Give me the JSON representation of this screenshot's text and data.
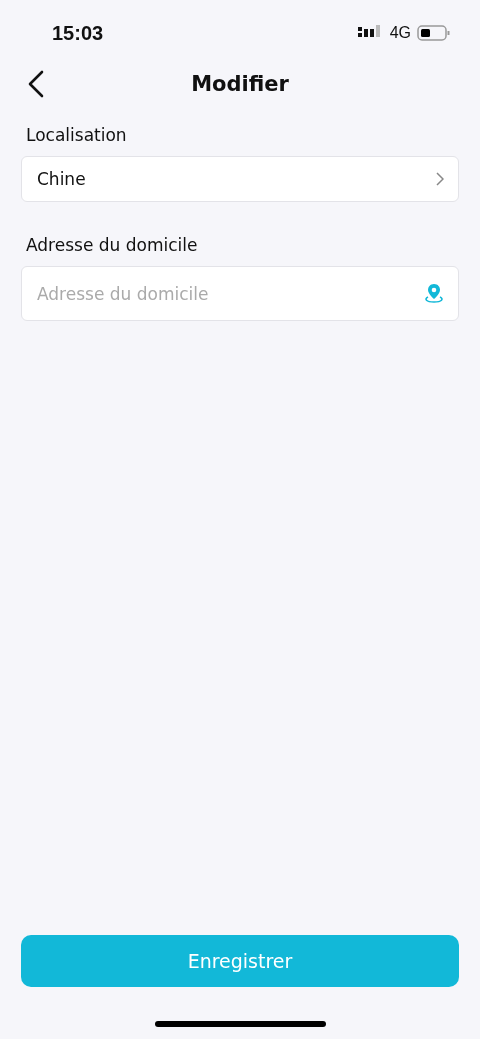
{
  "status_bar": {
    "time": "15:03",
    "network": "4G"
  },
  "nav": {
    "title": "Modifier"
  },
  "fields": [
    {
      "kind": "select",
      "label": "Localisation",
      "value": "Chine"
    },
    {
      "kind": "input",
      "label": "Adresse du domicile",
      "placeholder": "Adresse du domicile"
    }
  ],
  "save_button": "Enregistrer"
}
